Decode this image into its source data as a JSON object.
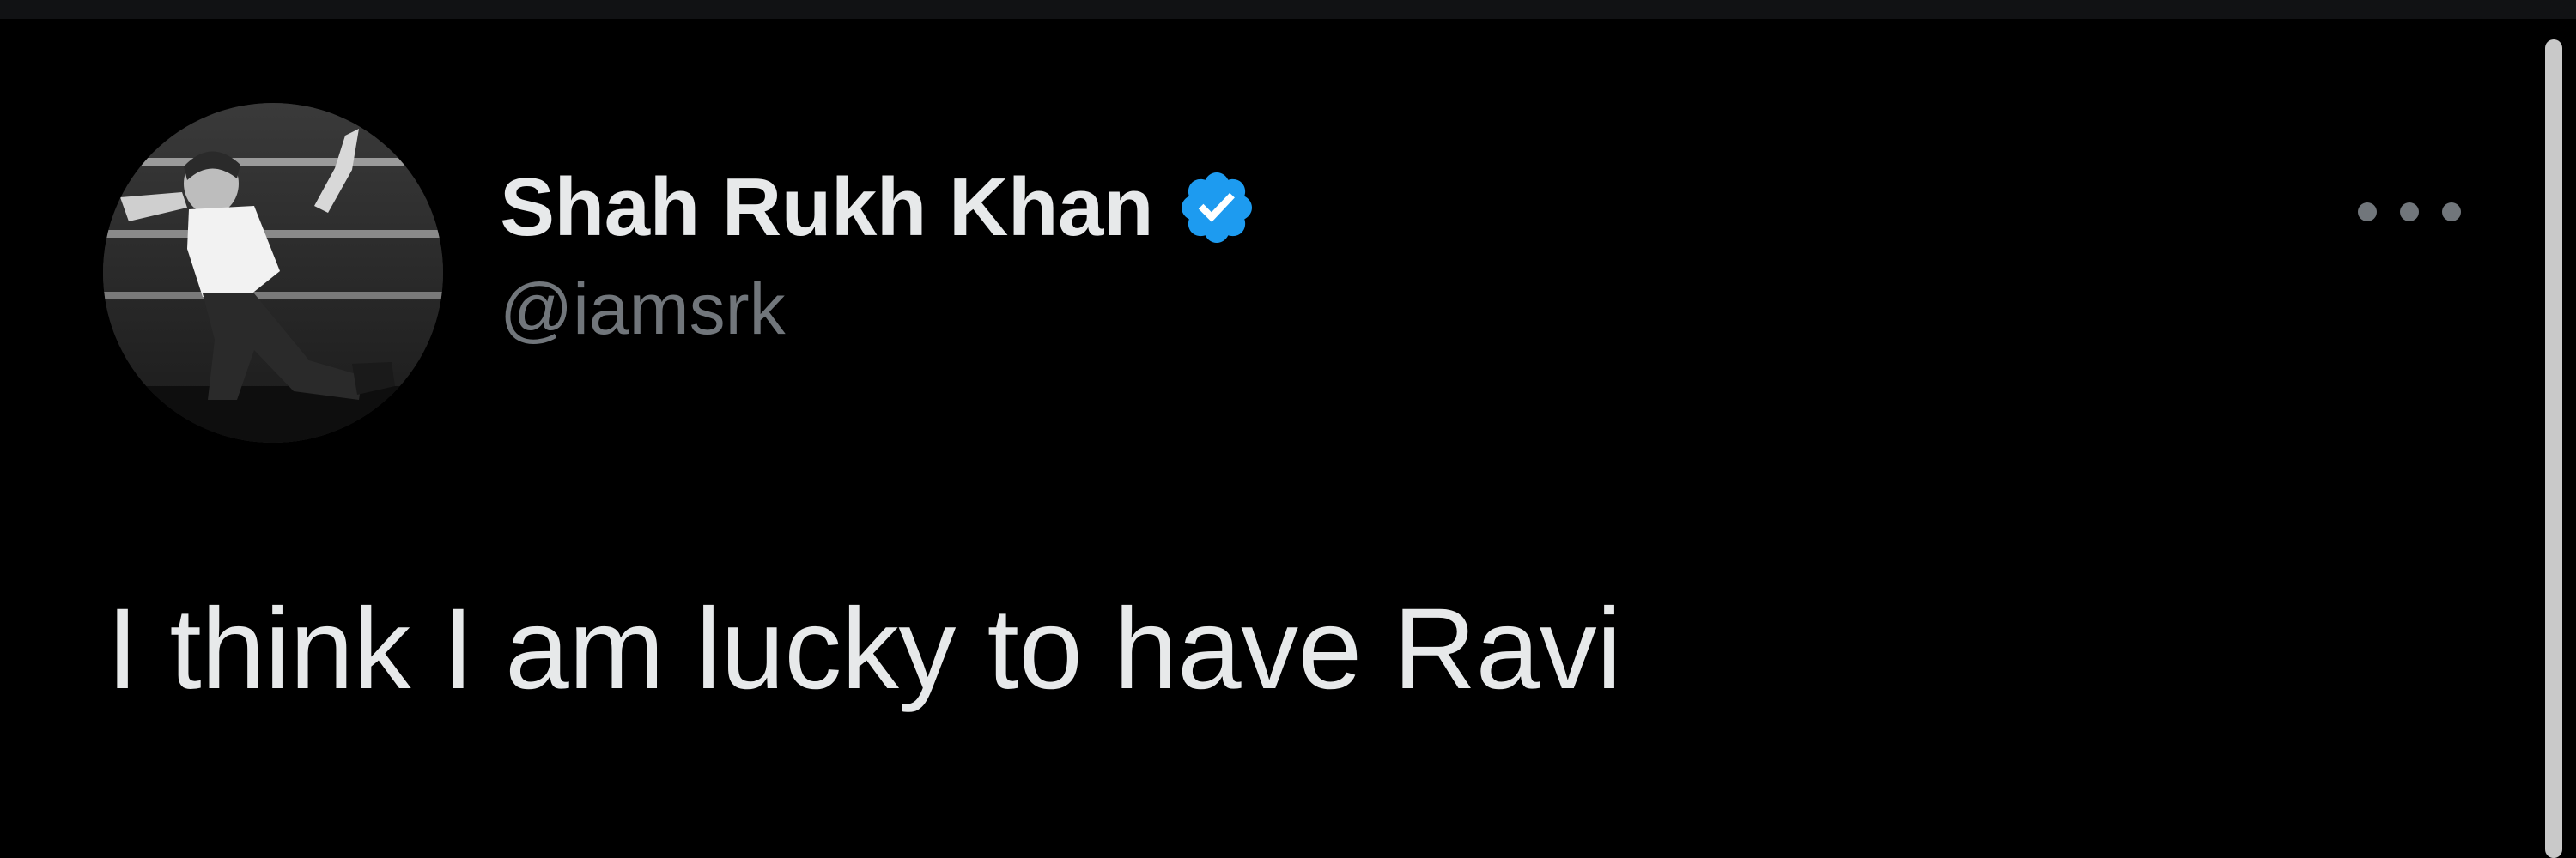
{
  "tweet": {
    "author": {
      "display_name": "Shah Rukh Khan",
      "handle": "@iamsrk",
      "verified": true,
      "verified_icon": "verified-badge-icon",
      "avatar_icon": "profile-photo"
    },
    "text": "I think I am lucky to have Ravi",
    "more_icon": "more-options-icon"
  },
  "colors": {
    "background": "#000000",
    "primary_text": "#e7e9ea",
    "secondary_text": "#71767b",
    "verified_blue": "#1d9bf0"
  }
}
